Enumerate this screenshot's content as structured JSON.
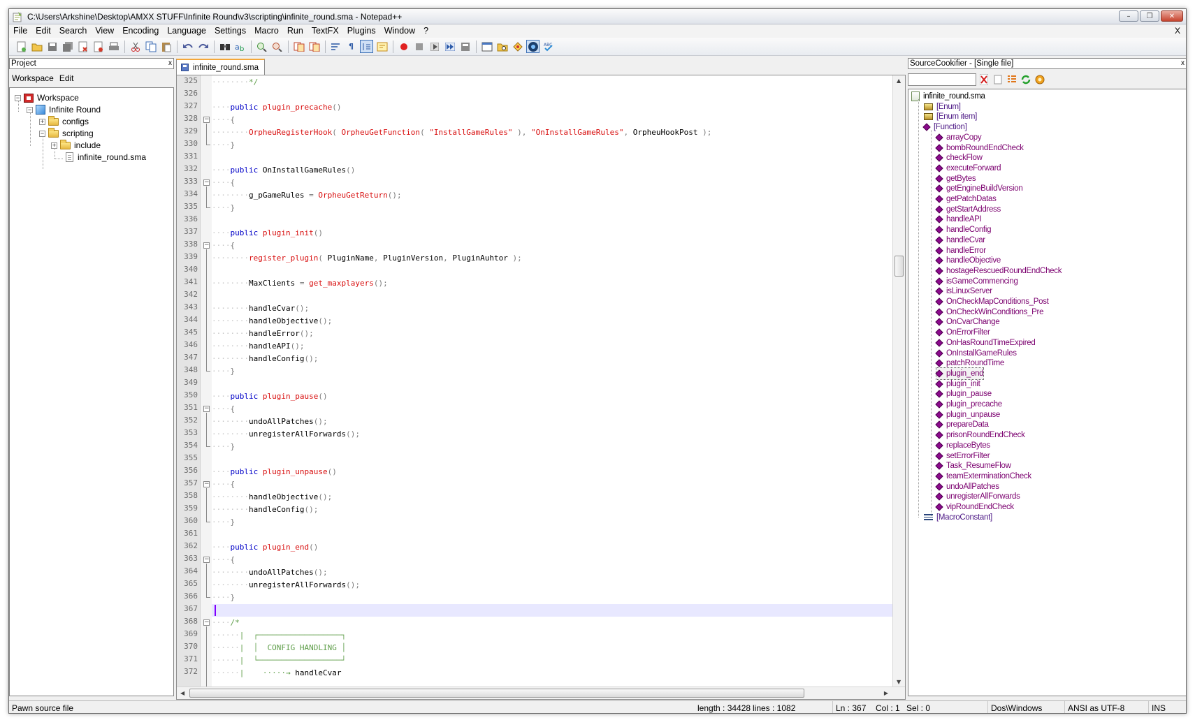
{
  "window": {
    "title": "C:\\Users\\Arkshine\\Desktop\\AMXX STUFF\\Infinite Round\\v3\\scripting\\infinite_round.sma - Notepad++",
    "minimize": "–",
    "restore": "❐",
    "close": "✕"
  },
  "menu": {
    "items": [
      "File",
      "Edit",
      "Search",
      "View",
      "Encoding",
      "Language",
      "Settings",
      "Macro",
      "Run",
      "TextFX",
      "Plugins",
      "Window",
      "?"
    ],
    "doc_close": "X"
  },
  "project": {
    "header": "Project",
    "close": "x",
    "tabs": [
      "Workspace",
      "Edit"
    ],
    "tree": {
      "workspace": "Workspace",
      "project": "Infinite Round",
      "configs": "configs",
      "scripting": "scripting",
      "include": "include",
      "file": "infinite_round.sma"
    }
  },
  "editor": {
    "tab_label": "infinite_round.sma",
    "first_line": 325,
    "caret_line": 367,
    "lines": [
      {
        "n": "325",
        "code": [
          [
            "dots",
            "····"
          ],
          [
            "cm",
            "*/"
          ]
        ]
      },
      {
        "n": "326",
        "code": []
      },
      {
        "n": "327",
        "code": [
          [
            "kw",
            "public "
          ],
          [
            "fn",
            "plugin_precache"
          ],
          [
            "op",
            "()"
          ]
        ]
      },
      {
        "n": "328",
        "code": [
          [
            "op",
            "{"
          ]
        ]
      },
      {
        "n": "329",
        "code": [
          [
            "dots",
            "····"
          ],
          [
            "fn",
            "OrpheuRegisterHook"
          ],
          [
            "op",
            "( "
          ],
          [
            "fn",
            "OrpheuGetFunction"
          ],
          [
            "op",
            "( "
          ],
          [
            "str",
            "\"InstallGameRules\""
          ],
          [
            "op",
            " ), "
          ],
          [
            "str",
            "\"OnInstallGameRules\""
          ],
          [
            "op",
            ", "
          ],
          [
            "",
            "OrpheuHookPost"
          ],
          [
            "op",
            " );"
          ]
        ]
      },
      {
        "n": "330",
        "code": [
          [
            "op",
            "}"
          ]
        ]
      },
      {
        "n": "331",
        "code": []
      },
      {
        "n": "332",
        "code": [
          [
            "kw",
            "public "
          ],
          [
            "",
            "OnInstallGameRules"
          ],
          [
            "op",
            "()"
          ]
        ]
      },
      {
        "n": "333",
        "code": [
          [
            "op",
            "{"
          ]
        ]
      },
      {
        "n": "334",
        "code": [
          [
            "dots",
            "····"
          ],
          [
            "",
            "g_pGameRules"
          ],
          [
            "op",
            " = "
          ],
          [
            "fn",
            "OrpheuGetReturn"
          ],
          [
            "op",
            "();"
          ]
        ]
      },
      {
        "n": "335",
        "code": [
          [
            "op",
            "}"
          ]
        ]
      },
      {
        "n": "336",
        "code": []
      },
      {
        "n": "337",
        "code": [
          [
            "kw",
            "public "
          ],
          [
            "fn",
            "plugin_init"
          ],
          [
            "op",
            "()"
          ]
        ]
      },
      {
        "n": "338",
        "code": [
          [
            "op",
            "{"
          ]
        ]
      },
      {
        "n": "339",
        "code": [
          [
            "dots",
            "····"
          ],
          [
            "fn",
            "register_plugin"
          ],
          [
            "op",
            "( "
          ],
          [
            "",
            "PluginName"
          ],
          [
            "op",
            ", "
          ],
          [
            "",
            "PluginVersion"
          ],
          [
            "op",
            ", "
          ],
          [
            "",
            "PluginAuhtor"
          ],
          [
            "op",
            " );"
          ]
        ]
      },
      {
        "n": "340",
        "code": []
      },
      {
        "n": "341",
        "code": [
          [
            "dots",
            "····"
          ],
          [
            "",
            "MaxClients"
          ],
          [
            "op",
            " = "
          ],
          [
            "fn",
            "get_maxplayers"
          ],
          [
            "op",
            "();"
          ]
        ]
      },
      {
        "n": "342",
        "code": []
      },
      {
        "n": "343",
        "code": [
          [
            "dots",
            "····"
          ],
          [
            "",
            "handleCvar"
          ],
          [
            "op",
            "();"
          ]
        ]
      },
      {
        "n": "344",
        "code": [
          [
            "dots",
            "····"
          ],
          [
            "",
            "handleObjective"
          ],
          [
            "op",
            "();"
          ]
        ]
      },
      {
        "n": "345",
        "code": [
          [
            "dots",
            "····"
          ],
          [
            "",
            "handleError"
          ],
          [
            "op",
            "();"
          ]
        ]
      },
      {
        "n": "346",
        "code": [
          [
            "dots",
            "····"
          ],
          [
            "",
            "handleAPI"
          ],
          [
            "op",
            "();"
          ]
        ]
      },
      {
        "n": "347",
        "code": [
          [
            "dots",
            "····"
          ],
          [
            "",
            "handleConfig"
          ],
          [
            "op",
            "();"
          ]
        ]
      },
      {
        "n": "348",
        "code": [
          [
            "op",
            "}"
          ]
        ]
      },
      {
        "n": "349",
        "code": []
      },
      {
        "n": "350",
        "code": [
          [
            "kw",
            "public "
          ],
          [
            "fn",
            "plugin_pause"
          ],
          [
            "op",
            "()"
          ]
        ]
      },
      {
        "n": "351",
        "code": [
          [
            "op",
            "{"
          ]
        ]
      },
      {
        "n": "352",
        "code": [
          [
            "dots",
            "····"
          ],
          [
            "",
            "undoAllPatches"
          ],
          [
            "op",
            "();"
          ]
        ]
      },
      {
        "n": "353",
        "code": [
          [
            "dots",
            "····"
          ],
          [
            "",
            "unregisterAllForwards"
          ],
          [
            "op",
            "();"
          ]
        ]
      },
      {
        "n": "354",
        "code": [
          [
            "op",
            "}"
          ]
        ]
      },
      {
        "n": "355",
        "code": []
      },
      {
        "n": "356",
        "code": [
          [
            "kw",
            "public "
          ],
          [
            "fn",
            "plugin_unpause"
          ],
          [
            "op",
            "()"
          ]
        ]
      },
      {
        "n": "357",
        "code": [
          [
            "op",
            "{"
          ]
        ]
      },
      {
        "n": "358",
        "code": [
          [
            "dots",
            "····"
          ],
          [
            "",
            "handleObjective"
          ],
          [
            "op",
            "();"
          ]
        ]
      },
      {
        "n": "359",
        "code": [
          [
            "dots",
            "····"
          ],
          [
            "",
            "handleConfig"
          ],
          [
            "op",
            "();"
          ]
        ]
      },
      {
        "n": "360",
        "code": [
          [
            "op",
            "}"
          ]
        ]
      },
      {
        "n": "361",
        "code": []
      },
      {
        "n": "362",
        "code": [
          [
            "kw",
            "public "
          ],
          [
            "fn",
            "plugin_end"
          ],
          [
            "op",
            "()"
          ]
        ]
      },
      {
        "n": "363",
        "code": [
          [
            "op",
            "{"
          ]
        ]
      },
      {
        "n": "364",
        "code": [
          [
            "dots",
            "····"
          ],
          [
            "",
            "undoAllPatches"
          ],
          [
            "op",
            "();"
          ]
        ]
      },
      {
        "n": "365",
        "code": [
          [
            "dots",
            "····"
          ],
          [
            "",
            "unregisterAllForwards"
          ],
          [
            "op",
            "();"
          ]
        ]
      },
      {
        "n": "366",
        "code": [
          [
            "op",
            "}"
          ]
        ]
      },
      {
        "n": "367",
        "code": []
      },
      {
        "n": "368",
        "code": [
          [
            "cm",
            "/*"
          ]
        ]
      },
      {
        "n": "369",
        "code": [
          [
            "dots",
            "··"
          ],
          [
            "cm",
            "|  ┌──────────────────┐"
          ]
        ]
      },
      {
        "n": "370",
        "code": [
          [
            "dots",
            "··"
          ],
          [
            "cm",
            "|  │  CONFIG HANDLING │"
          ]
        ]
      },
      {
        "n": "371",
        "code": [
          [
            "dots",
            "··"
          ],
          [
            "cm",
            "|  └──────────────────┘"
          ]
        ]
      },
      {
        "n": "372",
        "code": [
          [
            "dots",
            "··"
          ],
          [
            "cm",
            "|    ·····→ "
          ],
          [
            "",
            "handleCvar"
          ]
        ]
      }
    ],
    "fold_marks": [
      "328",
      "333",
      "338",
      "351",
      "357",
      "363",
      "368"
    ]
  },
  "source_cookifier": {
    "header": "SourceCookifier - [Single file]",
    "close": "x",
    "root": "infinite_round.sma",
    "categories": [
      "[Enum]",
      "[Enum item]",
      "[Function]",
      "[MacroConstant]"
    ],
    "functions": [
      "arrayCopy",
      "bombRoundEndCheck",
      "checkFlow",
      "executeForward",
      "getBytes",
      "getEngineBuildVersion",
      "getPatchDatas",
      "getStartAddress",
      "handleAPI",
      "handleConfig",
      "handleCvar",
      "handleError",
      "handleObjective",
      "hostageRescuedRoundEndCheck",
      "isGameCommencing",
      "isLinuxServer",
      "OnCheckMapConditions_Post",
      "OnCheckWinConditions_Pre",
      "OnCvarChange",
      "OnErrorFilter",
      "OnHasRoundTimeExpired",
      "OnInstallGameRules",
      "patchRoundTime",
      "plugin_end",
      "plugin_init",
      "plugin_pause",
      "plugin_precache",
      "plugin_unpause",
      "prepareData",
      "prisonRoundEndCheck",
      "replaceBytes",
      "setErrorFilter",
      "Task_ResumeFlow",
      "teamExterminationCheck",
      "undoAllPatches",
      "unregisterAllForwards",
      "vipRoundEndCheck"
    ],
    "selected": "plugin_end"
  },
  "status": {
    "file_type": "Pawn source file",
    "length": "length : 34428",
    "lines": "lines : 1082",
    "ln": "Ln : 367",
    "col": "Col : 1",
    "sel": "Sel : 0",
    "eol": "Dos\\Windows",
    "encoding": "ANSI as UTF-8",
    "mode": "INS"
  },
  "colors": {
    "keyword": "#0000c8",
    "function": "#d80e0e",
    "comment": "#5f9e4a",
    "caret_line": "#e8e8ff",
    "tab_accent": "#f4a73a"
  }
}
